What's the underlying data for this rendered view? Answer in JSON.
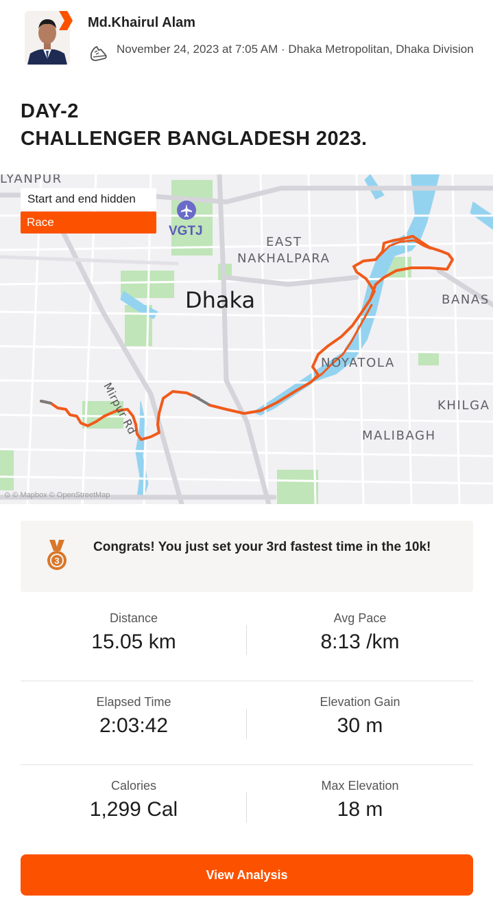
{
  "athlete": {
    "name": "Md.Khairul Alam",
    "meta": "November 24, 2023 at 7:05 AM · Dhaka Metropolitan, Dhaka Division"
  },
  "activity": {
    "title_line1": "DAY-2",
    "title_line2": "CHALLENGER BANGLADESH 2023."
  },
  "map": {
    "privacy_badge": "Start and end hidden",
    "type_badge": "Race",
    "airport_code": "VGTJ",
    "city": "Dhaka",
    "labels": {
      "kalyanpur": "LYANPUR",
      "east_nakhalpara_1": "EAST",
      "east_nakhalpara_2": "NAKHALPARA",
      "banasree": "BANAS",
      "noyatola": "NOYATOLA",
      "khilgaon": "KHILGA",
      "malibagh": "MALIBAGH",
      "mirpur_rd": "Mirpur Rd"
    },
    "attribution": "© Mapbox © OpenStreetMap"
  },
  "achievement": {
    "medal_rank": "3",
    "text": "Congrats! You just set your 3rd fastest time in the 10k!"
  },
  "stats": [
    {
      "left": {
        "label": "Distance",
        "value": "15.05 km"
      },
      "right": {
        "label": "Avg Pace",
        "value": "8:13 /km"
      }
    },
    {
      "left": {
        "label": "Elapsed Time",
        "value": "2:03:42"
      },
      "right": {
        "label": "Elevation Gain",
        "value": "30 m"
      }
    },
    {
      "left": {
        "label": "Calories",
        "value": "1,299 Cal"
      },
      "right": {
        "label": "Max Elevation",
        "value": "18 m"
      }
    }
  ],
  "cta": {
    "label": "View Analysis"
  },
  "colors": {
    "accent": "#fc5200",
    "route": "#f05a1a",
    "water": "#8fd0ee",
    "park": "#b9e3b3"
  }
}
